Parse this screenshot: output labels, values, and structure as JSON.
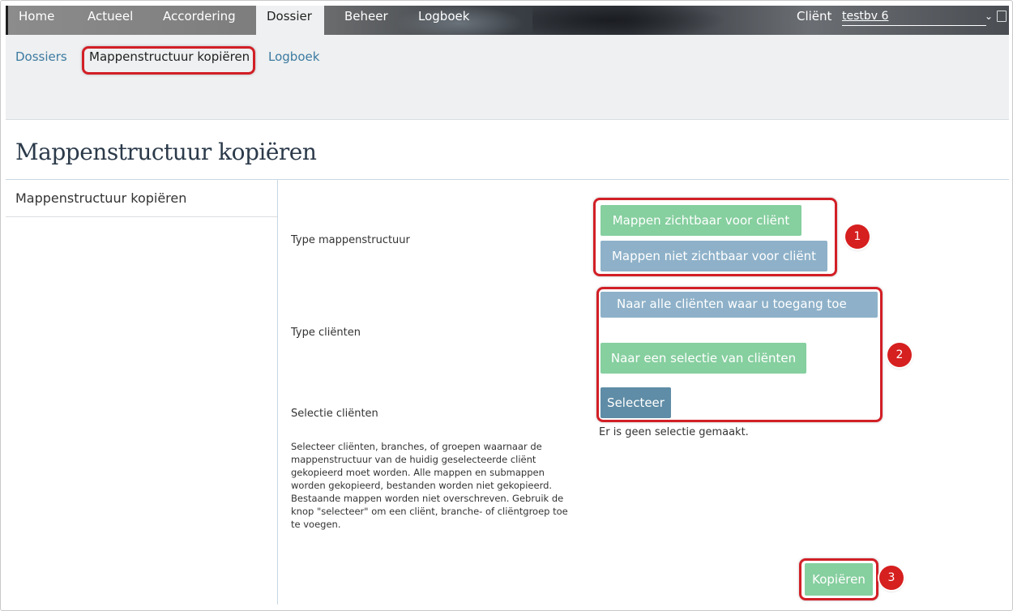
{
  "topnav": {
    "items": [
      "Home",
      "Actueel",
      "Accordering",
      "Dossier",
      "Beheer",
      "Logboek"
    ],
    "active": "Dossier",
    "client_label": "Cliënt",
    "client_value": "testbv 6"
  },
  "subnav": {
    "items": [
      "Dossiers",
      "Mappenstructuur kopiëren",
      "Logboek"
    ],
    "active": "Mappenstructuur kopiëren"
  },
  "page": {
    "title": "Mappenstructuur kopiëren"
  },
  "sidebar": {
    "items": [
      {
        "label": "Mappenstructuur kopiëren"
      }
    ]
  },
  "form": {
    "type_mappenstructuur": {
      "label": "Type mappenstructuur",
      "options": [
        "Mappen zichtbaar voor cliënt",
        "Mappen niet zichtbaar voor cliënt"
      ]
    },
    "type_clienten": {
      "label": "Type cliënten",
      "options": [
        "Naar alle cliënten waar u toegang toe",
        "Naar een selectie van cliënten"
      ]
    },
    "selectie_clienten": {
      "label": "Selectie cliënten",
      "button": "Selecteer",
      "empty_note": "Er is geen selectie gemaakt.",
      "help": "Selecteer cliënten, branches, of groepen waarnaar de mappenstructuur van de huidig geselecteerde cliënt gekopieerd moet worden. Alle mappen en submappen worden gekopieerd, bestanden worden niet gekopieerd. Bestaande mappen worden niet overschreven. Gebruik de knop \"selecteer\" om een cliënt, branche- of cliëntgroep toe te voegen."
    },
    "submit": "Kopiëren"
  },
  "annotations": [
    "1",
    "2",
    "3"
  ],
  "colors": {
    "green_button": "#86cf9f",
    "blue_button": "#8eb1c9",
    "dark_button": "#5f8ca6",
    "highlight": "#d21f26",
    "badge": "#d61f1f",
    "link": "#3c7aa0"
  }
}
